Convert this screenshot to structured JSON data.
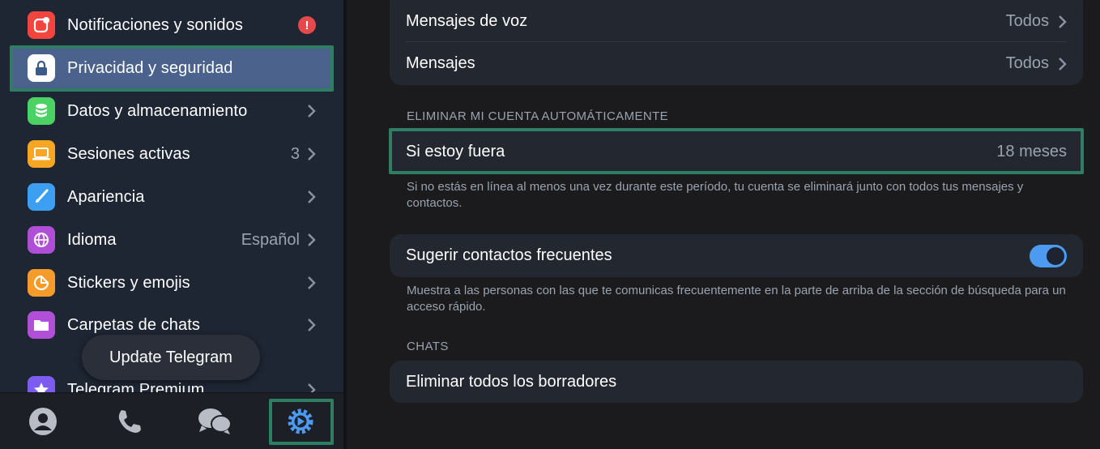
{
  "sidebar": {
    "items": [
      {
        "label": "Notificaciones y sonidos",
        "icon": "bell-icon",
        "color": "#f2453d",
        "right": "!"
      },
      {
        "label": "Privacidad y seguridad",
        "icon": "lock-icon",
        "color": "#ffffff"
      },
      {
        "label": "Datos y almacenamiento",
        "icon": "database-icon",
        "color": "#4cd263"
      },
      {
        "label": "Sesiones activas",
        "icon": "laptop-icon",
        "color": "#f5a623",
        "right": "3"
      },
      {
        "label": "Apariencia",
        "icon": "brush-icon",
        "color": "#3d9ff2"
      },
      {
        "label": "Idioma",
        "icon": "globe-icon",
        "color": "#b14ed8",
        "right": "Español"
      },
      {
        "label": "Stickers y emojis",
        "icon": "sticker-icon",
        "color": "#f59b2a"
      },
      {
        "label": "Carpetas de chats",
        "icon": "folder-icon",
        "color": "#b24fd9"
      },
      {
        "label": "Telegram Premium",
        "icon": "star-icon",
        "color": "#7d5cf0"
      }
    ],
    "update_button": "Update Telegram",
    "tabs": [
      "profile-icon",
      "phone-icon",
      "chats-icon",
      "settings-icon"
    ]
  },
  "main": {
    "voice_messages": {
      "label": "Mensajes de voz",
      "value": "Todos"
    },
    "messages": {
      "label": "Mensajes",
      "value": "Todos"
    },
    "delete_section": "ELIMINAR MI CUENTA AUTOMÁTICAMENTE",
    "if_away": {
      "label": "Si estoy fuera",
      "value": "18 meses"
    },
    "if_away_note": "Si no estás en línea al menos una vez durante este período, tu cuenta se eliminará junto con todos tus mensajes y contactos.",
    "suggest": {
      "label": "Sugerir contactos frecuentes",
      "on": true
    },
    "suggest_note": "Muestra a las personas con las que te comunicas frecuentemente en la parte de arriba de la sección de búsqueda para un acceso rápido.",
    "chats_section": "CHATS",
    "delete_drafts": "Eliminar todos los borradores"
  },
  "colors": {
    "accent": "#4d9bf0",
    "highlight": "#2f7d63",
    "selected": "#4a628c"
  }
}
